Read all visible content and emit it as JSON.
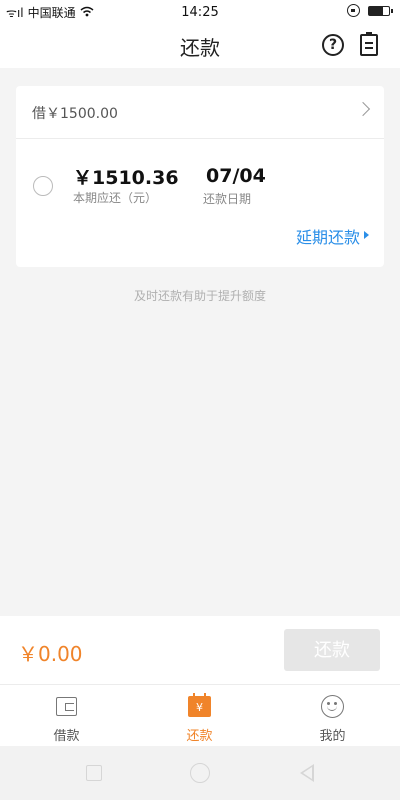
{
  "status_bar": {
    "carrier": "中国联通",
    "signal_text": "ᯤıl",
    "wifi_icon": "wifi-icon",
    "time": "14:25",
    "battery_level": 0.7
  },
  "header": {
    "title": "还款",
    "help_icon": "question-circle-icon",
    "help_symbol": "?",
    "record_icon": "notepad-icon"
  },
  "loan": {
    "label": "借￥1500.00"
  },
  "bill": {
    "amount": "￥1510.36",
    "amount_caption": "本期应还（元）",
    "due_date": "07/04",
    "due_date_caption": "还款日期",
    "extend_label": "延期还款"
  },
  "hint": "及时还款有助于提升额度",
  "checkout": {
    "total": "￥0.00",
    "button_label": "还款"
  },
  "tabs": [
    {
      "label": "借款",
      "icon": "wallet-icon",
      "active": false
    },
    {
      "label": "还款",
      "icon": "calendar-yen-icon",
      "icon_text": "¥",
      "active": true
    },
    {
      "label": "我的",
      "icon": "smile-icon",
      "active": false
    }
  ],
  "colors": {
    "accent": "#f0842a",
    "link": "#2b8fe8",
    "disabled_button": "#e6e6e6",
    "background": "#f4f4f4"
  }
}
